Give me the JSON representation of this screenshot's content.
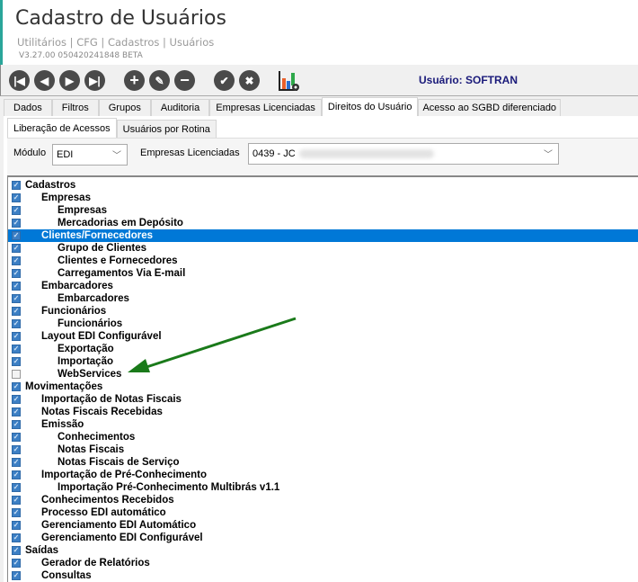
{
  "header": {
    "title": "Cadastro de Usuários",
    "breadcrumb": "Utilitários | CFG | Cadastros | Usuários",
    "version": "V3.27.00 050420241848 BETA"
  },
  "toolbar": {
    "buttons": [
      "first-icon",
      "previous-icon",
      "next-icon",
      "last-icon",
      "add-icon",
      "edit-icon",
      "remove-icon",
      "confirm-icon",
      "cancel-icon",
      "chart-settings-icon"
    ],
    "user_label": "Usuário:  SOFTRAN"
  },
  "tabs": [
    "Dados",
    "Filtros",
    "Grupos",
    "Auditoria",
    "Empresas Licenciadas",
    "Direitos do Usuário",
    "Acesso ao SGBD diferenciado"
  ],
  "active_tab": "Direitos do Usuário",
  "subtabs": [
    "Liberação de Acessos",
    "Usuários por Rotina"
  ],
  "form": {
    "modulo_label": "Módulo",
    "modulo_value": "EDI",
    "empresas_label": "Empresas Licenciadas",
    "empresas_value": "0439 - JC"
  },
  "tree": [
    {
      "label": "Cadastros",
      "level": 0,
      "checked": true
    },
    {
      "label": "Empresas",
      "level": 1,
      "checked": true
    },
    {
      "label": "Empresas",
      "level": 2,
      "checked": true
    },
    {
      "label": "Mercadorias em Depósito",
      "level": 2,
      "checked": true
    },
    {
      "label": "Clientes/Fornecedores",
      "level": 1,
      "checked": true,
      "selected": true
    },
    {
      "label": "Grupo de Clientes",
      "level": 2,
      "checked": true
    },
    {
      "label": "Clientes e Fornecedores",
      "level": 2,
      "checked": true
    },
    {
      "label": "Carregamentos Via E-mail",
      "level": 2,
      "checked": true
    },
    {
      "label": "Embarcadores",
      "level": 1,
      "checked": true
    },
    {
      "label": "Embarcadores",
      "level": 2,
      "checked": true
    },
    {
      "label": "Funcionários",
      "level": 1,
      "checked": true
    },
    {
      "label": "Funcionários",
      "level": 2,
      "checked": true
    },
    {
      "label": "Layout EDI Configurável",
      "level": 1,
      "checked": true
    },
    {
      "label": "Exportação",
      "level": 2,
      "checked": true
    },
    {
      "label": "Importação",
      "level": 2,
      "checked": true
    },
    {
      "label": "WebServices",
      "level": 2,
      "checked": false
    },
    {
      "label": "Movimentações",
      "level": 0,
      "checked": true
    },
    {
      "label": "Importação de Notas Fiscais",
      "level": 1,
      "checked": true
    },
    {
      "label": "Notas Fiscais Recebidas",
      "level": 1,
      "checked": true
    },
    {
      "label": "Emissão",
      "level": 1,
      "checked": true
    },
    {
      "label": "Conhecimentos",
      "level": 2,
      "checked": true
    },
    {
      "label": "Notas Fiscais",
      "level": 2,
      "checked": true
    },
    {
      "label": "Notas Fiscais de Serviço",
      "level": 2,
      "checked": true
    },
    {
      "label": "Importação de Pré-Conhecimento",
      "level": 1,
      "checked": true
    },
    {
      "label": "Importação Pré-Conhecimento Multibrás v1.1",
      "level": 2,
      "checked": true
    },
    {
      "label": "Conhecimentos Recebidos",
      "level": 1,
      "checked": true
    },
    {
      "label": "Processo EDI automático",
      "level": 1,
      "checked": true
    },
    {
      "label": "Gerenciamento EDI Automático",
      "level": 1,
      "checked": true
    },
    {
      "label": "Gerenciamento EDI Configurável",
      "level": 1,
      "checked": true
    },
    {
      "label": "Saídas",
      "level": 0,
      "checked": true
    },
    {
      "label": "Gerador de Relatórios",
      "level": 1,
      "checked": true
    },
    {
      "label": "Consultas",
      "level": 1,
      "checked": true
    }
  ],
  "colors": {
    "accent": "#2aa59a",
    "selection": "#0078d7",
    "checkbox": "#3c7fc4",
    "arrow": "#1a7a1a",
    "user": "#1a1a7a"
  }
}
